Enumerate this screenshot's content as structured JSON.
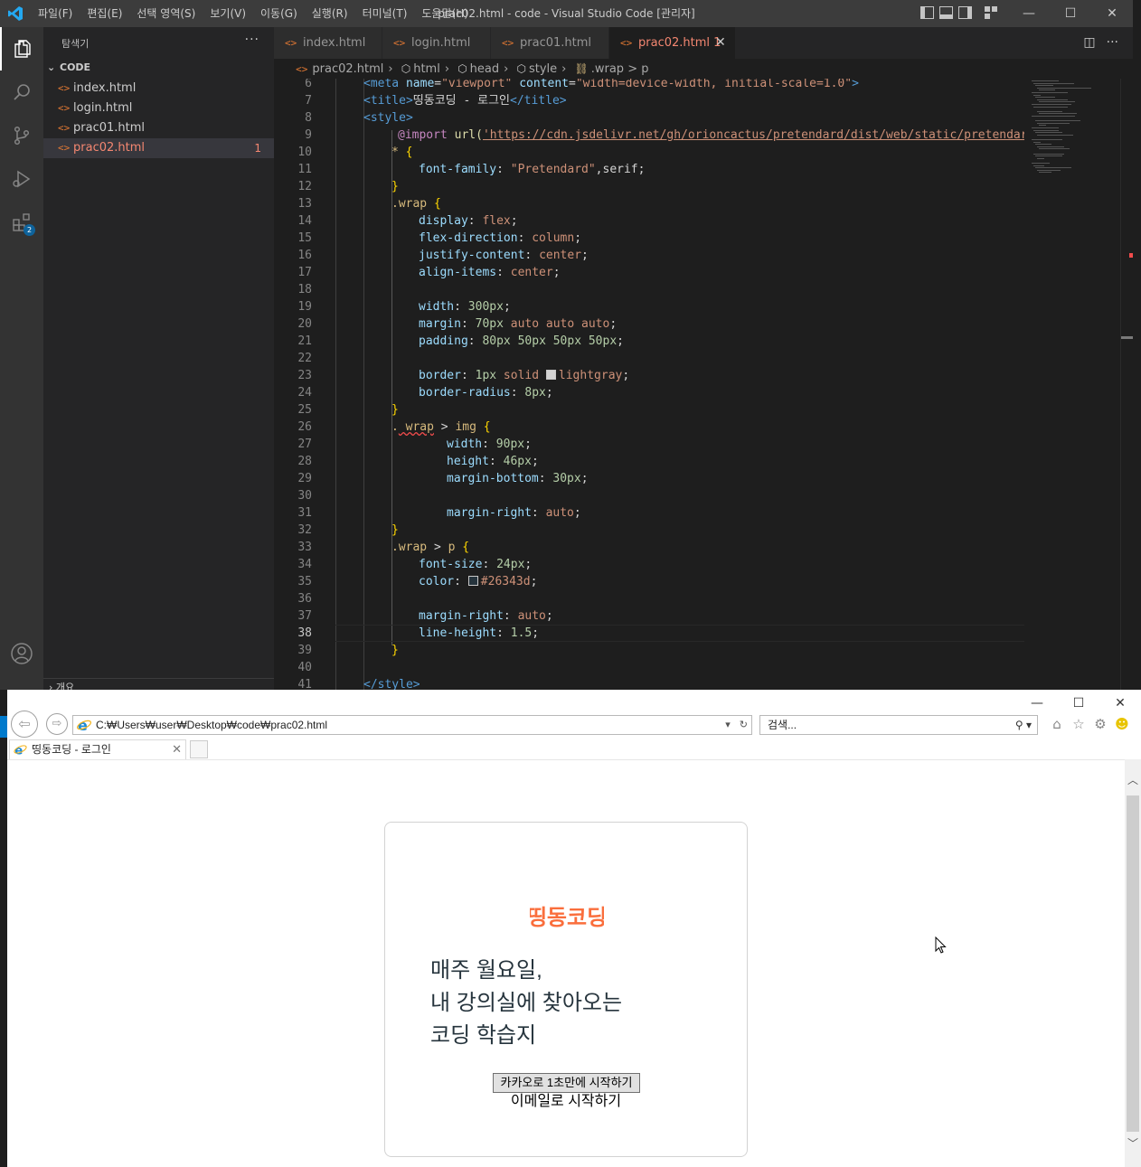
{
  "vscode": {
    "menu": [
      "파일(F)",
      "편집(E)",
      "선택 영역(S)",
      "보기(V)",
      "이동(G)",
      "실행(R)",
      "터미널(T)",
      "도움말(H)"
    ],
    "window_title": "prac02.html - code - Visual Studio Code [관리자]",
    "activity": {
      "extensions_badge": "2"
    },
    "sidebar": {
      "title": "탐색기",
      "more": "···",
      "section": "CODE",
      "files": [
        {
          "name": "index.html",
          "count": ""
        },
        {
          "name": "login.html",
          "count": ""
        },
        {
          "name": "prac01.html",
          "count": ""
        },
        {
          "name": "prac02.html",
          "count": "1"
        }
      ],
      "bottom_section": "개요"
    },
    "tabs": [
      {
        "label": "index.html"
      },
      {
        "label": "login.html"
      },
      {
        "label": "prac01.html"
      },
      {
        "label": "prac02.html 1"
      }
    ],
    "breadcrumb": [
      "prac02.html",
      "html",
      "head",
      "style",
      ".wrap > p"
    ],
    "line_numbers": [
      "6",
      "7",
      "8",
      "9",
      "10",
      "11",
      "12",
      "13",
      "14",
      "15",
      "16",
      "17",
      "18",
      "19",
      "20",
      "21",
      "22",
      "23",
      "24",
      "25",
      "26",
      "27",
      "28",
      "29",
      "30",
      "31",
      "32",
      "33",
      "34",
      "35",
      "36",
      "37",
      "38",
      "39",
      "40",
      "41"
    ],
    "current_line": "38",
    "code": {
      "l6": [
        "<meta",
        " name",
        "=",
        "\"viewport\"",
        " content",
        "=",
        "\"width=device-width, initial-scale=1.0\"",
        ">"
      ],
      "l7": [
        "<title>",
        "띵동코딩 - 로그인",
        "</title>"
      ],
      "l8": [
        "<style>"
      ],
      "l9": [
        "@import",
        " url(",
        "'https://cdn.jsdelivr.net/gh/orioncactus/pretendard/dist/web/static/pretendard"
      ],
      "l10": [
        "*",
        " {"
      ],
      "l11": [
        "font-family",
        ": ",
        "\"Pretendard\"",
        ",serif;"
      ],
      "l12": [
        "}"
      ],
      "l13": [
        ".wrap",
        " {"
      ],
      "l14": [
        "display",
        ": ",
        "flex",
        ";"
      ],
      "l15": [
        "flex-direction",
        ": ",
        "column",
        ";"
      ],
      "l16": [
        "justify-content",
        ": ",
        "center",
        ";"
      ],
      "l17": [
        "align-items",
        ": ",
        "center",
        ";"
      ],
      "l19": [
        "width",
        ": ",
        "300px",
        ";"
      ],
      "l20": [
        "margin",
        ": ",
        "70px",
        " auto auto auto",
        ";"
      ],
      "l21": [
        "padding",
        ": ",
        "80px 50px 50px 50px",
        ";"
      ],
      "l23": [
        "border",
        ": ",
        "1px",
        " solid ",
        "lightgray",
        ";"
      ],
      "l24": [
        "border-radius",
        ": ",
        "8px",
        ";"
      ],
      "l25": [
        "}"
      ],
      "l26": [
        ".",
        " wrap",
        " > ",
        "img",
        " {"
      ],
      "l27": [
        "width",
        ": ",
        "90px",
        ";"
      ],
      "l28": [
        "height",
        ": ",
        "46px",
        ";"
      ],
      "l29": [
        "margin-bottom",
        ": ",
        "30px",
        ";"
      ],
      "l31": [
        "margin-right",
        ": ",
        "auto",
        ";"
      ],
      "l32": [
        "}"
      ],
      "l33": [
        ".wrap",
        " > ",
        "p",
        " {"
      ],
      "l34": [
        "font-size",
        ": ",
        "24px",
        ";"
      ],
      "l35": [
        "color",
        ": ",
        "#26343d",
        ";"
      ],
      "l37": [
        "margin-right",
        ": ",
        "auto",
        ";"
      ],
      "l38": [
        "line-height",
        ": ",
        "1.5",
        ";"
      ],
      "l39": [
        "}"
      ],
      "l41": [
        "</style>"
      ]
    },
    "colors": {
      "lightgray": "#d3d3d3",
      "navy": "#26343d"
    }
  },
  "ie": {
    "address": "C:₩Users₩user₩Desktop₩code₩prac02.html",
    "search_placeholder": "검색...",
    "tab_title": "띵동코딩 - 로그인",
    "page": {
      "logo_text": "띵동코딩",
      "tagline": [
        "매주 월요일,",
        "내 강의실에 찾아오는",
        "코딩 학습지"
      ],
      "kakao_button": "카카오로 1초만에 시작하기",
      "email_link": "이메일로 시작하기"
    },
    "colors": {
      "logo": "#fa6e3c",
      "text": "#26343d"
    }
  }
}
